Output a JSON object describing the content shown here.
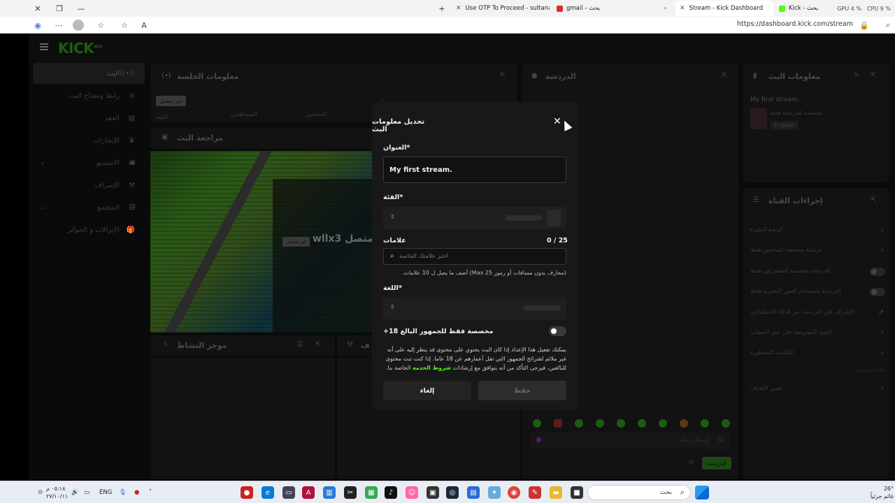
{
  "browser": {
    "tabs": [
      {
        "title": "Use OTP To Proceed - sultanalasi",
        "icon": "mail-icon"
      },
      {
        "title": "gmail - بحث",
        "icon": "gmail-icon"
      },
      {
        "title": "Stream - Kick Dashboard",
        "icon": "kick-icon",
        "active": true
      },
      {
        "title": "Kick - بحث",
        "icon": "kick-icon"
      }
    ],
    "url": "https://dashboard.kick.com/stream",
    "sysinfo": {
      "gpu": "GPU 4 %",
      "cpu": "CPU 9 %"
    }
  },
  "app": {
    "logo": "KICK",
    "logo_badge": "BETA",
    "sidebar": [
      {
        "label": "البث",
        "icon": "broadcast-icon",
        "active": true
      },
      {
        "label": "رابط ومفتاح البث",
        "icon": "link-icon"
      },
      {
        "label": "العقد",
        "icon": "contract-icon"
      },
      {
        "label": "الإنجازات",
        "icon": "trophy-icon"
      },
      {
        "label": "الاستديو",
        "icon": "studio-icon",
        "chevron": true
      },
      {
        "label": "الإشراف",
        "icon": "moderation-icon"
      },
      {
        "label": "المجتمع",
        "icon": "community-icon",
        "chevron": true
      },
      {
        "label": "الإنزالات و الجوائز",
        "icon": "gift-icon"
      }
    ],
    "session_panel": {
      "title": "معلومات الجلسة",
      "offline_badge": "غير متصل",
      "stats": [
        {
          "label": "البثية",
          "value": ""
        },
        {
          "label": "المشاهدين",
          "value": "-"
        },
        {
          "label": "المتابعين",
          "value": "-"
        },
        {
          "label": "",
          "value": "-"
        }
      ]
    },
    "preview_panel": {
      "title": "مراجعة البث",
      "channel_text": "wllx3 متصل",
      "offline_badge": "غير متصل"
    },
    "activity_panel": {
      "title": "موجز النشاط",
      "title2": "ف"
    },
    "chat_panel": {
      "title": "الدردشة",
      "input_placeholder": "إرسال رسالة",
      "send_button": "الدردشة"
    },
    "stream_info_panel": {
      "title": "معلومات البث",
      "stream_title": "My first stream.",
      "category": "مخصصة للدردشة فقط",
      "language": "English"
    },
    "channel_actions": {
      "title": "إجراءات القناة",
      "items": [
        {
          "label": "الوضع البطيء",
          "type": "chevron"
        },
        {
          "label": "دردشة مخصصة للمتابعين فقط",
          "type": "chevron"
        },
        {
          "label": "الدردشة مخصصة للمشتركين فقط",
          "type": "toggle"
        },
        {
          "label": "الدردشة باستخدام الصور التعبيرية فقط",
          "type": "toggle"
        },
        {
          "label": "الإشراف على الدردشة عبر الذكاء الاصطناعي",
          "type": "link"
        },
        {
          "label": "القيود المفروضة على عمر الحساب",
          "type": "chevron"
        },
        {
          "label": "الكلمات المحظورة",
          "type": "chevron"
        },
        {
          "label": "القناة المضيفة",
          "type": "none"
        },
        {
          "label": "تعيين الأهداف",
          "type": "chevron"
        }
      ]
    }
  },
  "modal": {
    "title": "تحديل معلومات البث",
    "title_label": "العنوان*",
    "title_value": "My first stream.",
    "category_label": "الفئة*",
    "tags_label": "علامات",
    "tags_counter": "0 / 25",
    "tags_placeholder": "اختر علامتك الخاصة",
    "tags_hint": "(محارف بدون مسافات أو رموز Max 25) أضف ما يصل ل 10 علامات.",
    "language_label": "اللغة*",
    "adult_label": "+مخصصة فقط للجمهور البالغ 18",
    "adult_enabled": false,
    "description_before": "يمكنك تفعيل هذا الإعداد إذا كان البث يحتوي على محتوى قد ينظر إليه على أنه غير ملائم لشرائح الجمهور التي تقل أعمارهم عن 18 عاما. إذا كنت تبث محتوى للبالغين، فيرجى التأكد من أنه يتوافق مع إرشادات",
    "description_link": "شروط الخدمة",
    "description_after": "الخاصة بنا.",
    "cancel_button": "إلغاء",
    "save_button": "حفظ"
  },
  "taskbar": {
    "search_placeholder": "بحث",
    "lang": "ENG",
    "time": "٠٥:١٨ م",
    "date": "٢٧/١٠/١١",
    "temperature": "26°",
    "weather": "غائم جزئياً"
  },
  "colors": {
    "accent": "#53fc18",
    "modal_bg": "#181818",
    "page_bg": "#0a0a0a"
  }
}
